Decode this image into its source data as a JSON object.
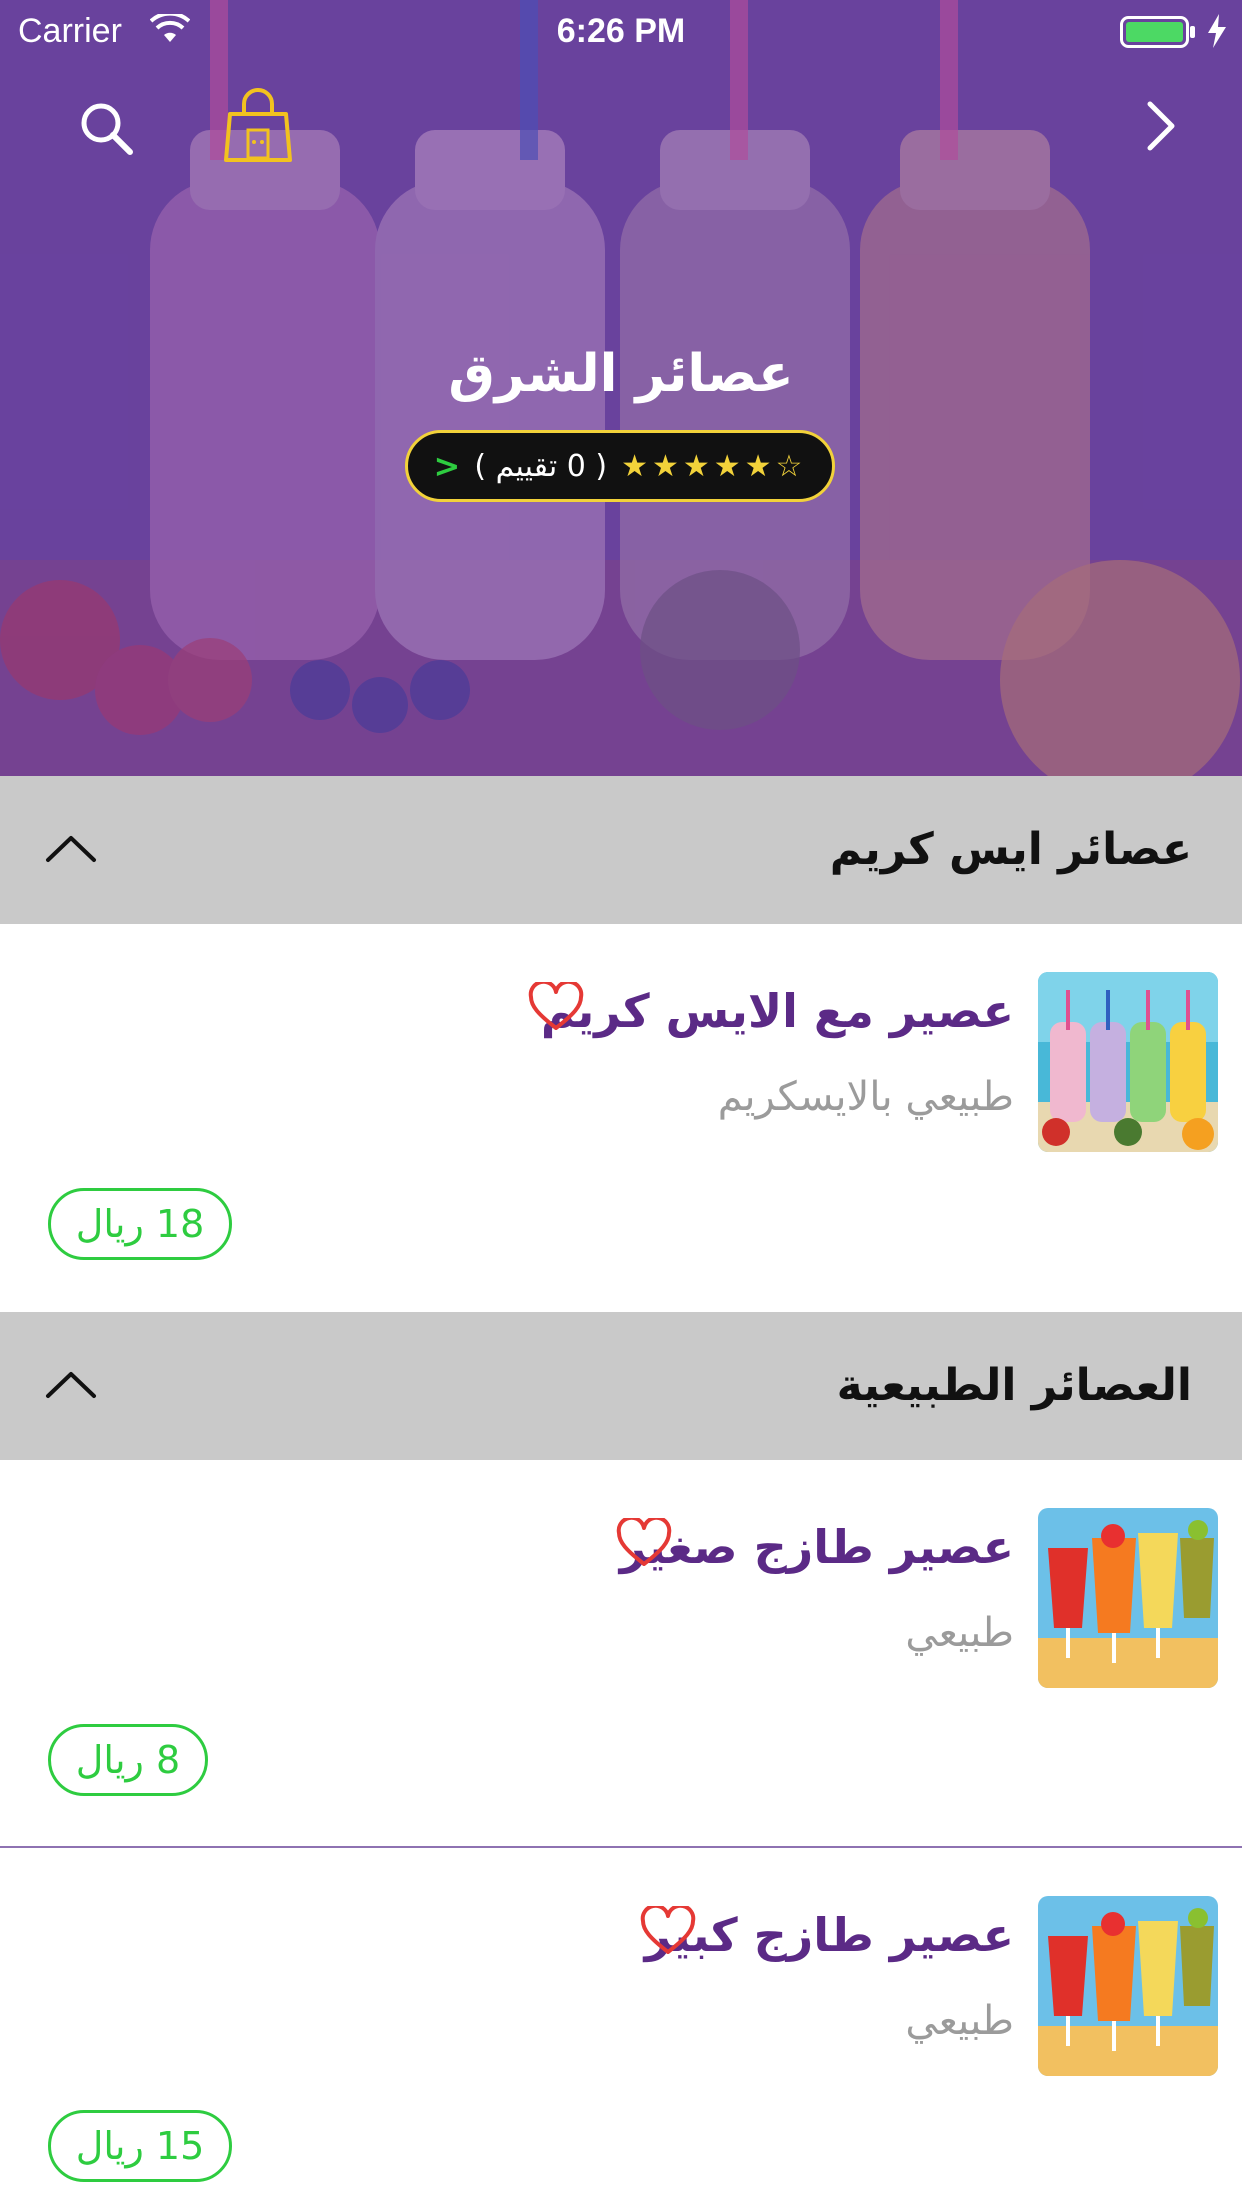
{
  "status_bar": {
    "carrier": "Carrier",
    "time": "6:26 PM",
    "wifi_icon": "wifi-icon",
    "battery_icon": "battery-icon"
  },
  "nav": {
    "search_icon": "search-icon",
    "cart_icon": "shopping-bag-icon",
    "forward_icon": "chevron-right-icon"
  },
  "store": {
    "name": "عصائر الشرق",
    "rating_text": "( 0 تقييم )",
    "stars_filled": "★★★★★",
    "stars_empty": "☆",
    "rating_chevron": ">"
  },
  "sections": [
    {
      "title": "عصائر ايس كريم",
      "items": [
        {
          "name": "عصير مع الايس كريم",
          "description": "طبيعي بالايسكريم",
          "price": "18 ريال"
        }
      ]
    },
    {
      "title": "العصائر الطبيعية",
      "items": [
        {
          "name": "عصير طازج صغير",
          "description": "طبيعي",
          "price": "8 ريال"
        },
        {
          "name": "عصير طازج كبير",
          "description": "طبيعي",
          "price": "15 ريال"
        }
      ]
    }
  ],
  "colors": {
    "brand_purple": "#5b2a86",
    "price_green": "#2ecc40",
    "heart_red": "#e53935",
    "star_yellow": "#f2d23a",
    "section_gray": "#c9c9c9"
  }
}
